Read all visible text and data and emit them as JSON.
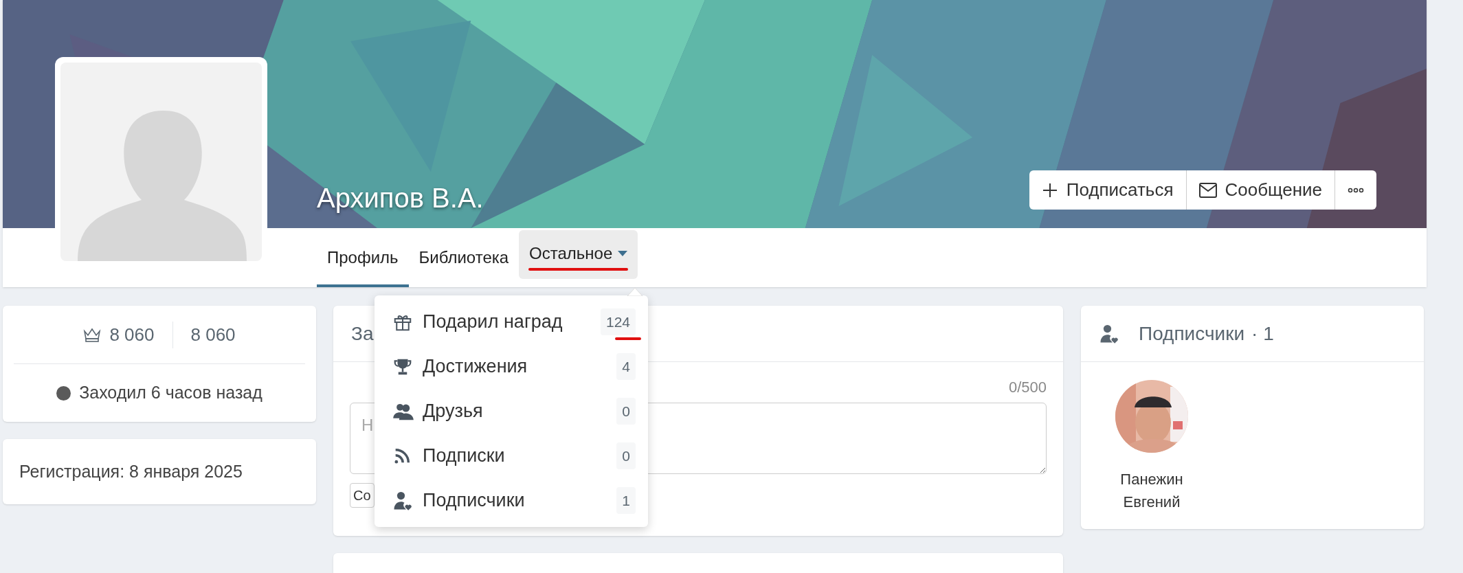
{
  "profile": {
    "name": "Архипов В.А."
  },
  "actions": [
    {
      "kind": "subscribe",
      "label": "Подписаться"
    },
    {
      "kind": "message",
      "label": "Сообщение"
    },
    {
      "kind": "more"
    }
  ],
  "tabs": [
    {
      "label": "Профиль",
      "selected": true,
      "dropdown": false,
      "marked": false
    },
    {
      "label": "Библиотека",
      "selected": false,
      "dropdown": false,
      "marked": false
    },
    {
      "label": "Остальное",
      "selected": false,
      "dropdown": true,
      "marked": true
    }
  ],
  "dropdown_menu": {
    "items": [
      {
        "kind": "gift",
        "label": "Подарил наград",
        "count": "124",
        "marked": true
      },
      {
        "kind": "trophy",
        "label": "Достижения",
        "count": "4",
        "marked": false
      },
      {
        "kind": "friends",
        "label": "Друзья",
        "count": "0",
        "marked": false
      },
      {
        "kind": "rss",
        "label": "Подписки",
        "count": "0",
        "marked": false
      },
      {
        "kind": "follower",
        "label": "Подписчики",
        "count": "1",
        "marked": false
      }
    ]
  },
  "stats_card": {
    "rating": "8 060",
    "points": "8 060",
    "status": "Заходил 6 часов назад",
    "online": false
  },
  "registration_card": {
    "text": "Регистрация: 8 января 2025"
  },
  "wall_card": {
    "title": "За",
    "counter": "0/500",
    "placeholder": "Н",
    "button": "Со"
  },
  "followers_card": {
    "title": "Подписчики",
    "separator": "·",
    "count": "1",
    "followers": [
      {
        "first_line": "Панежин",
        "second_line": "Евгений"
      }
    ]
  }
}
